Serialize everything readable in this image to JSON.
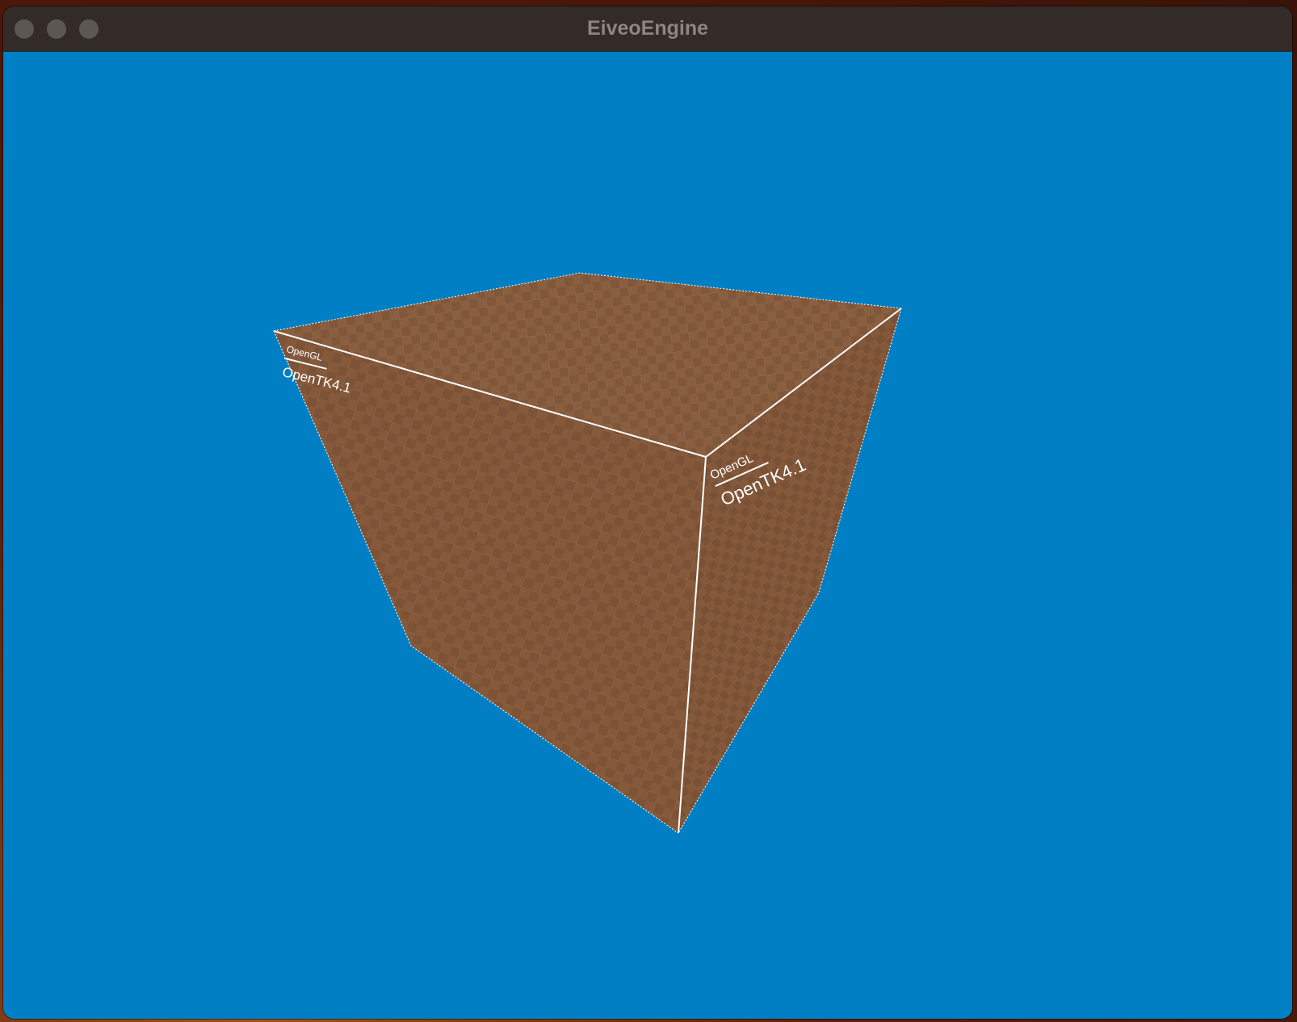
{
  "window": {
    "title": "EiveoEngine"
  },
  "viewport": {
    "background_color": "#007fc4"
  },
  "cube": {
    "face_color": "#7f5538",
    "edge_color": "#ffffff",
    "labels": {
      "left_face": {
        "top": "OpenGL",
        "bottom": "OpenTK4.1"
      },
      "right_face": {
        "top": "OpenGL",
        "bottom": "OpenTK4.1"
      }
    }
  }
}
